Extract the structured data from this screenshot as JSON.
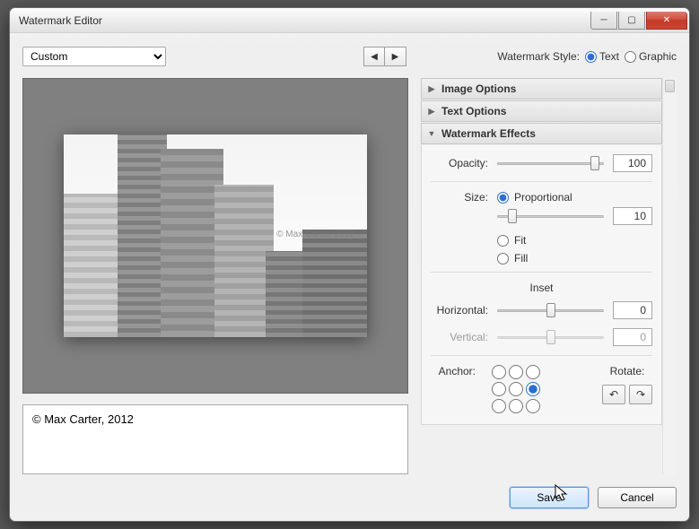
{
  "window": {
    "title": "Watermark Editor"
  },
  "preset": {
    "selected": "Custom"
  },
  "style": {
    "label": "Watermark Style:",
    "text": "Text",
    "graphic": "Graphic",
    "selected": "text"
  },
  "preview": {
    "watermark_overlay": "© Max Carter, 2012"
  },
  "text_input": {
    "value": "© Max Carter, 2012"
  },
  "sections": {
    "image_options": "Image Options",
    "text_options": "Text Options",
    "watermark_effects": "Watermark Effects"
  },
  "effects": {
    "opacity": {
      "label": "Opacity:",
      "value": 100,
      "thumb_pct": 92
    },
    "size": {
      "label": "Size:",
      "mode": "proportional",
      "proportional": "Proportional",
      "fit": "Fit",
      "fill": "Fill",
      "value": 10,
      "thumb_pct": 14
    },
    "inset": {
      "label": "Inset",
      "horizontal": {
        "label": "Horizontal:",
        "value": 0,
        "thumb_pct": 50
      },
      "vertical": {
        "label": "Vertical:",
        "value": 0,
        "thumb_pct": 50,
        "enabled": false
      }
    },
    "anchor": {
      "label": "Anchor:",
      "row": 1,
      "col": 2
    },
    "rotate": {
      "label": "Rotate:"
    }
  },
  "footer": {
    "save": "Save",
    "cancel": "Cancel"
  }
}
